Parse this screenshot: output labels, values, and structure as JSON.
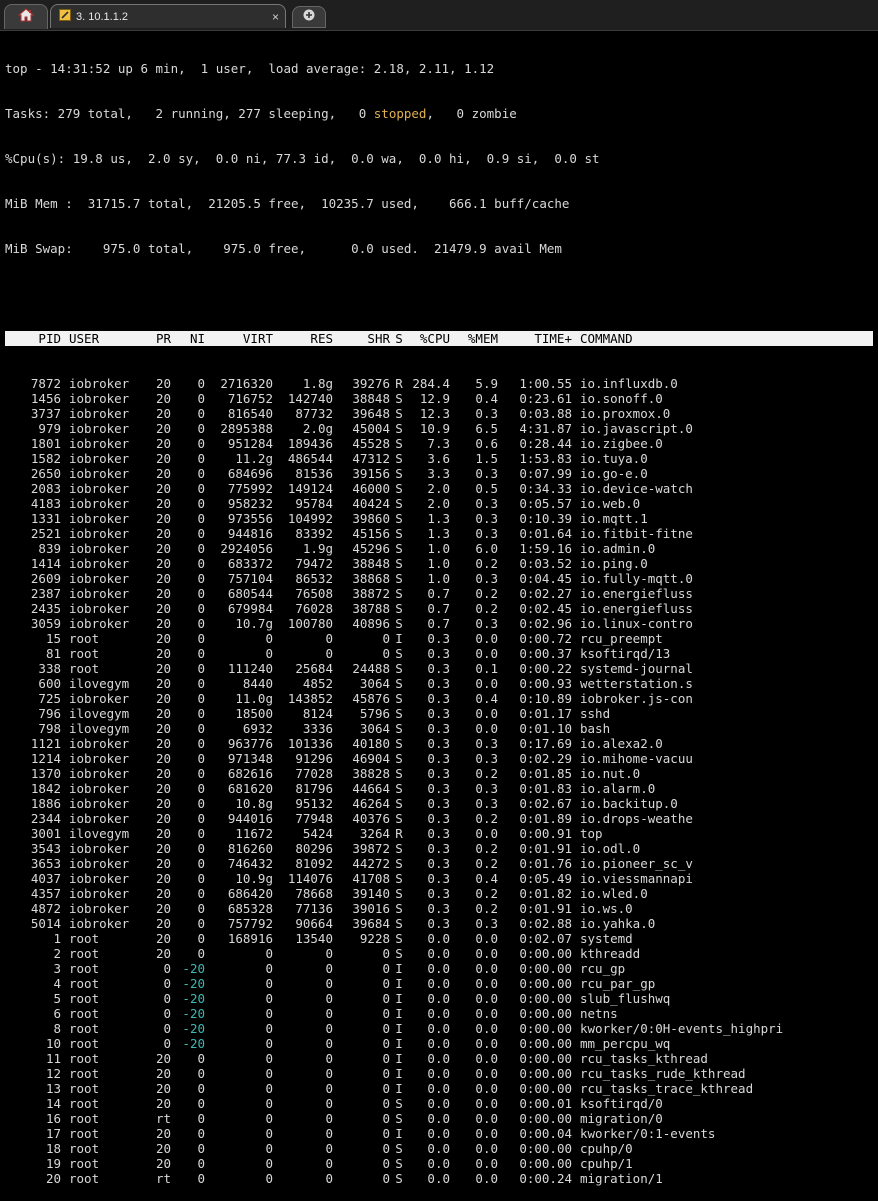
{
  "tabs": {
    "home_icon": "home-icon",
    "session_title": "3. 10.1.1.2",
    "close_glyph": "×",
    "new_tab_icon": "plus-icon"
  },
  "summary": {
    "line1": "top - 14:31:52 up 6 min,  1 user,  load average: 2.18, 2.11, 1.12",
    "tasks_prefix": "Tasks: 279 total,   2 running, 277 sleeping,   0 ",
    "tasks_stopped": "stopped",
    "tasks_suffix": ",   0 zombie",
    "cpu": "%Cpu(s): 19.8 us,  2.0 sy,  0.0 ni, 77.3 id,  0.0 wa,  0.0 hi,  0.9 si,  0.0 st",
    "mem": "MiB Mem :  31715.7 total,  21205.5 free,  10235.7 used,    666.1 buff/cache",
    "swap": "MiB Swap:    975.0 total,    975.0 free,      0.0 used.  21479.9 avail Mem"
  },
  "headers": [
    "PID",
    "USER",
    "PR",
    "NI",
    "VIRT",
    "RES",
    "SHR",
    "S",
    "%CPU",
    "%MEM",
    "TIME+",
    "COMMAND"
  ],
  "rows": [
    [
      "7872",
      "iobroker",
      "20",
      "0",
      "2716320",
      "1.8g",
      "39276",
      "R",
      "284.4",
      "5.9",
      "1:00.55",
      "io.influxdb.0"
    ],
    [
      "1456",
      "iobroker",
      "20",
      "0",
      "716752",
      "142740",
      "38848",
      "S",
      "12.9",
      "0.4",
      "0:23.61",
      "io.sonoff.0"
    ],
    [
      "3737",
      "iobroker",
      "20",
      "0",
      "816540",
      "87732",
      "39648",
      "S",
      "12.3",
      "0.3",
      "0:03.88",
      "io.proxmox.0"
    ],
    [
      "979",
      "iobroker",
      "20",
      "0",
      "2895388",
      "2.0g",
      "45004",
      "S",
      "10.9",
      "6.5",
      "4:31.87",
      "io.javascript.0"
    ],
    [
      "1801",
      "iobroker",
      "20",
      "0",
      "951284",
      "189436",
      "45528",
      "S",
      "7.3",
      "0.6",
      "0:28.44",
      "io.zigbee.0"
    ],
    [
      "1582",
      "iobroker",
      "20",
      "0",
      "11.2g",
      "486544",
      "47312",
      "S",
      "3.6",
      "1.5",
      "1:53.83",
      "io.tuya.0"
    ],
    [
      "2650",
      "iobroker",
      "20",
      "0",
      "684696",
      "81536",
      "39156",
      "S",
      "3.3",
      "0.3",
      "0:07.99",
      "io.go-e.0"
    ],
    [
      "2083",
      "iobroker",
      "20",
      "0",
      "775992",
      "149124",
      "46000",
      "S",
      "2.0",
      "0.5",
      "0:34.33",
      "io.device-watch"
    ],
    [
      "4183",
      "iobroker",
      "20",
      "0",
      "958232",
      "95784",
      "40424",
      "S",
      "2.0",
      "0.3",
      "0:05.57",
      "io.web.0"
    ],
    [
      "1331",
      "iobroker",
      "20",
      "0",
      "973556",
      "104992",
      "39860",
      "S",
      "1.3",
      "0.3",
      "0:10.39",
      "io.mqtt.1"
    ],
    [
      "2521",
      "iobroker",
      "20",
      "0",
      "944816",
      "83392",
      "45156",
      "S",
      "1.3",
      "0.3",
      "0:01.64",
      "io.fitbit-fitne"
    ],
    [
      "839",
      "iobroker",
      "20",
      "0",
      "2924056",
      "1.9g",
      "45296",
      "S",
      "1.0",
      "6.0",
      "1:59.16",
      "io.admin.0"
    ],
    [
      "1414",
      "iobroker",
      "20",
      "0",
      "683372",
      "79472",
      "38848",
      "S",
      "1.0",
      "0.2",
      "0:03.52",
      "io.ping.0"
    ],
    [
      "2609",
      "iobroker",
      "20",
      "0",
      "757104",
      "86532",
      "38868",
      "S",
      "1.0",
      "0.3",
      "0:04.45",
      "io.fully-mqtt.0"
    ],
    [
      "2387",
      "iobroker",
      "20",
      "0",
      "680544",
      "76508",
      "38872",
      "S",
      "0.7",
      "0.2",
      "0:02.27",
      "io.energiefluss"
    ],
    [
      "2435",
      "iobroker",
      "20",
      "0",
      "679984",
      "76028",
      "38788",
      "S",
      "0.7",
      "0.2",
      "0:02.45",
      "io.energiefluss"
    ],
    [
      "3059",
      "iobroker",
      "20",
      "0",
      "10.7g",
      "100780",
      "40896",
      "S",
      "0.7",
      "0.3",
      "0:02.96",
      "io.linux-contro"
    ],
    [
      "15",
      "root",
      "20",
      "0",
      "0",
      "0",
      "0",
      "I",
      "0.3",
      "0.0",
      "0:00.72",
      "rcu_preempt"
    ],
    [
      "81",
      "root",
      "20",
      "0",
      "0",
      "0",
      "0",
      "S",
      "0.3",
      "0.0",
      "0:00.37",
      "ksoftirqd/13"
    ],
    [
      "338",
      "root",
      "20",
      "0",
      "111240",
      "25684",
      "24488",
      "S",
      "0.3",
      "0.1",
      "0:00.22",
      "systemd-journal"
    ],
    [
      "600",
      "ilovegym",
      "20",
      "0",
      "8440",
      "4852",
      "3064",
      "S",
      "0.3",
      "0.0",
      "0:00.93",
      "wetterstation.s"
    ],
    [
      "725",
      "iobroker",
      "20",
      "0",
      "11.0g",
      "143852",
      "45876",
      "S",
      "0.3",
      "0.4",
      "0:10.89",
      "iobroker.js-con"
    ],
    [
      "796",
      "ilovegym",
      "20",
      "0",
      "18500",
      "8124",
      "5796",
      "S",
      "0.3",
      "0.0",
      "0:01.17",
      "sshd"
    ],
    [
      "798",
      "ilovegym",
      "20",
      "0",
      "6932",
      "3336",
      "3064",
      "S",
      "0.3",
      "0.0",
      "0:01.10",
      "bash"
    ],
    [
      "1121",
      "iobroker",
      "20",
      "0",
      "963776",
      "101336",
      "40180",
      "S",
      "0.3",
      "0.3",
      "0:17.69",
      "io.alexa2.0"
    ],
    [
      "1214",
      "iobroker",
      "20",
      "0",
      "971348",
      "91296",
      "46904",
      "S",
      "0.3",
      "0.3",
      "0:02.29",
      "io.mihome-vacuu"
    ],
    [
      "1370",
      "iobroker",
      "20",
      "0",
      "682616",
      "77028",
      "38828",
      "S",
      "0.3",
      "0.2",
      "0:01.85",
      "io.nut.0"
    ],
    [
      "1842",
      "iobroker",
      "20",
      "0",
      "681620",
      "81796",
      "44664",
      "S",
      "0.3",
      "0.3",
      "0:01.83",
      "io.alarm.0"
    ],
    [
      "1886",
      "iobroker",
      "20",
      "0",
      "10.8g",
      "95132",
      "46264",
      "S",
      "0.3",
      "0.3",
      "0:02.67",
      "io.backitup.0"
    ],
    [
      "2344",
      "iobroker",
      "20",
      "0",
      "944016",
      "77948",
      "40376",
      "S",
      "0.3",
      "0.2",
      "0:01.89",
      "io.drops-weathe"
    ],
    [
      "3001",
      "ilovegym",
      "20",
      "0",
      "11672",
      "5424",
      "3264",
      "R",
      "0.3",
      "0.0",
      "0:00.91",
      "top"
    ],
    [
      "3543",
      "iobroker",
      "20",
      "0",
      "816260",
      "80296",
      "39872",
      "S",
      "0.3",
      "0.2",
      "0:01.91",
      "io.odl.0"
    ],
    [
      "3653",
      "iobroker",
      "20",
      "0",
      "746432",
      "81092",
      "44272",
      "S",
      "0.3",
      "0.2",
      "0:01.76",
      "io.pioneer_sc_v"
    ],
    [
      "4037",
      "iobroker",
      "20",
      "0",
      "10.9g",
      "114076",
      "41708",
      "S",
      "0.3",
      "0.4",
      "0:05.49",
      "io.viessmannapi"
    ],
    [
      "4357",
      "iobroker",
      "20",
      "0",
      "686420",
      "78668",
      "39140",
      "S",
      "0.3",
      "0.2",
      "0:01.82",
      "io.wled.0"
    ],
    [
      "4872",
      "iobroker",
      "20",
      "0",
      "685328",
      "77136",
      "39016",
      "S",
      "0.3",
      "0.2",
      "0:01.91",
      "io.ws.0"
    ],
    [
      "5014",
      "iobroker",
      "20",
      "0",
      "757792",
      "90664",
      "39684",
      "S",
      "0.3",
      "0.3",
      "0:02.88",
      "io.yahka.0"
    ],
    [
      "1",
      "root",
      "20",
      "0",
      "168916",
      "13540",
      "9228",
      "S",
      "0.0",
      "0.0",
      "0:02.07",
      "systemd"
    ],
    [
      "2",
      "root",
      "20",
      "0",
      "0",
      "0",
      "0",
      "S",
      "0.0",
      "0.0",
      "0:00.00",
      "kthreadd"
    ],
    [
      "3",
      "root",
      "0",
      "-20",
      "0",
      "0",
      "0",
      "I",
      "0.0",
      "0.0",
      "0:00.00",
      "rcu_gp"
    ],
    [
      "4",
      "root",
      "0",
      "-20",
      "0",
      "0",
      "0",
      "I",
      "0.0",
      "0.0",
      "0:00.00",
      "rcu_par_gp"
    ],
    [
      "5",
      "root",
      "0",
      "-20",
      "0",
      "0",
      "0",
      "I",
      "0.0",
      "0.0",
      "0:00.00",
      "slub_flushwq"
    ],
    [
      "6",
      "root",
      "0",
      "-20",
      "0",
      "0",
      "0",
      "I",
      "0.0",
      "0.0",
      "0:00.00",
      "netns"
    ],
    [
      "8",
      "root",
      "0",
      "-20",
      "0",
      "0",
      "0",
      "I",
      "0.0",
      "0.0",
      "0:00.00",
      "kworker/0:0H-events_highpri"
    ],
    [
      "10",
      "root",
      "0",
      "-20",
      "0",
      "0",
      "0",
      "I",
      "0.0",
      "0.0",
      "0:00.00",
      "mm_percpu_wq"
    ],
    [
      "11",
      "root",
      "20",
      "0",
      "0",
      "0",
      "0",
      "I",
      "0.0",
      "0.0",
      "0:00.00",
      "rcu_tasks_kthread"
    ],
    [
      "12",
      "root",
      "20",
      "0",
      "0",
      "0",
      "0",
      "I",
      "0.0",
      "0.0",
      "0:00.00",
      "rcu_tasks_rude_kthread"
    ],
    [
      "13",
      "root",
      "20",
      "0",
      "0",
      "0",
      "0",
      "I",
      "0.0",
      "0.0",
      "0:00.00",
      "rcu_tasks_trace_kthread"
    ],
    [
      "14",
      "root",
      "20",
      "0",
      "0",
      "0",
      "0",
      "S",
      "0.0",
      "0.0",
      "0:00.01",
      "ksoftirqd/0"
    ],
    [
      "16",
      "root",
      "rt",
      "0",
      "0",
      "0",
      "0",
      "S",
      "0.0",
      "0.0",
      "0:00.00",
      "migration/0"
    ],
    [
      "17",
      "root",
      "20",
      "0",
      "0",
      "0",
      "0",
      "I",
      "0.0",
      "0.0",
      "0:00.04",
      "kworker/0:1-events"
    ],
    [
      "18",
      "root",
      "20",
      "0",
      "0",
      "0",
      "0",
      "S",
      "0.0",
      "0.0",
      "0:00.00",
      "cpuhp/0"
    ],
    [
      "19",
      "root",
      "20",
      "0",
      "0",
      "0",
      "0",
      "S",
      "0.0",
      "0.0",
      "0:00.00",
      "cpuhp/1"
    ],
    [
      "20",
      "root",
      "rt",
      "0",
      "0",
      "0",
      "0",
      "S",
      "0.0",
      "0.0",
      "0:00.24",
      "migration/1"
    ]
  ],
  "colors": {
    "background": "#000000",
    "text": "#d9d9d9",
    "header_bg": "#f2f2f2",
    "negative_nice": "#3cb8b0",
    "stopped": "#e0b050"
  }
}
